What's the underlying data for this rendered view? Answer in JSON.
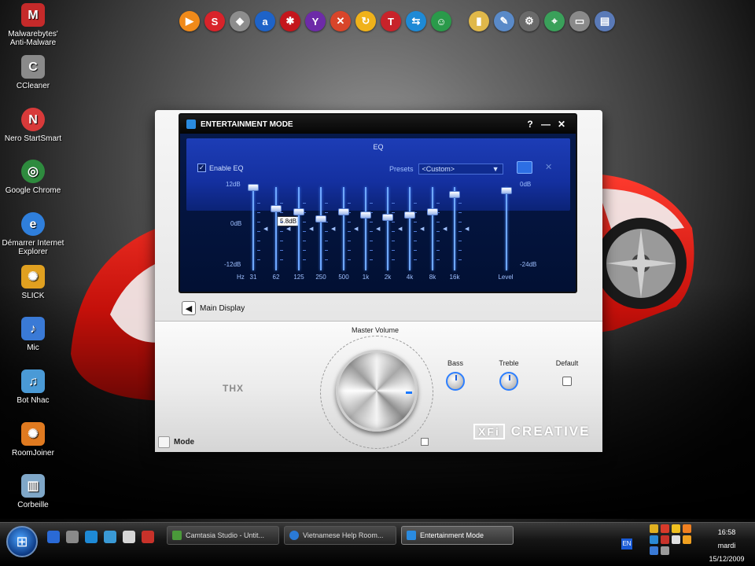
{
  "desktop": {
    "icons": [
      {
        "label": "Malwarebytes' Anti-Malware",
        "icon": "malwarebytes-icon",
        "glyph": "M",
        "color": "#c52a2a"
      },
      {
        "label": "CCleaner",
        "icon": "ccleaner-icon",
        "glyph": "C",
        "color": "#8a8a8a"
      },
      {
        "label": "Nero StartSmart",
        "icon": "nero-icon",
        "glyph": "N",
        "color": "#d83a3a"
      },
      {
        "label": "Google Chrome",
        "icon": "chrome-icon",
        "glyph": "◎",
        "color": "#2e8b3e"
      },
      {
        "label": "Démarrer Internet Explorer",
        "icon": "internet-explorer-icon",
        "glyph": "e",
        "color": "#2f7fdc"
      },
      {
        "label": "SLICK",
        "icon": "slick-icon",
        "glyph": "✺",
        "color": "#e0a020"
      },
      {
        "label": "Mic",
        "icon": "microphone-icon",
        "glyph": "♪",
        "color": "#3a7ad6"
      },
      {
        "label": "Bot Nhac",
        "icon": "bot-nhac-icon",
        "glyph": "♫",
        "color": "#4a9ad6"
      },
      {
        "label": "RoomJoiner",
        "icon": "roomjoiner-icon",
        "glyph": "✺",
        "color": "#e07a20"
      },
      {
        "label": "Corbeille",
        "icon": "recycle-bin-icon",
        "glyph": "▥",
        "color": "#7fa7c8"
      }
    ]
  },
  "top_bar": {
    "icons": [
      {
        "name": "media-player-icon",
        "glyph": "▶",
        "color": "#f08a1a"
      },
      {
        "name": "shell-icon",
        "glyph": "S",
        "color": "#d8232a"
      },
      {
        "name": "shield-icon",
        "glyph": "◆",
        "color": "#8d8d8d"
      },
      {
        "name": "avast-icon",
        "glyph": "a",
        "color": "#1e63c8"
      },
      {
        "name": "spider-icon",
        "glyph": "✱",
        "color": "#c4161c"
      },
      {
        "name": "yahoo-icon",
        "glyph": "Y",
        "color": "#6d2ba8"
      },
      {
        "name": "pinwheel-icon",
        "glyph": "✕",
        "color": "#d8452a"
      },
      {
        "name": "sync-icon",
        "glyph": "↻",
        "color": "#f0b21a"
      },
      {
        "name": "tweak-icon",
        "glyph": "T",
        "color": "#c8232a"
      },
      {
        "name": "teamviewer-icon",
        "glyph": "⇆",
        "color": "#1e8ad6"
      },
      {
        "name": "users-icon",
        "glyph": "☺",
        "color": "#2a9a4a"
      },
      {
        "name": "folder-icon",
        "glyph": "▮",
        "color": "#e0b84a"
      },
      {
        "name": "notepad-icon",
        "glyph": "✎",
        "color": "#5a8ac8"
      },
      {
        "name": "settings-gear-icon",
        "glyph": "⚙",
        "color": "#6a6a6a"
      },
      {
        "name": "map-icon",
        "glyph": "⌖",
        "color": "#3aa05a"
      },
      {
        "name": "network-icon",
        "glyph": "▭",
        "color": "#8a8a8a"
      },
      {
        "name": "monitor-icon",
        "glyph": "▤",
        "color": "#5a7ab8"
      }
    ]
  },
  "window": {
    "title": "ENTERTAINMENT MODE",
    "help_glyph": "?",
    "minimize_glyph": "—",
    "close_glyph": "✕",
    "eq": {
      "heading": "EQ",
      "enable_label": "Enable EQ",
      "enable_checked": "✓",
      "presets_label": "Presets",
      "preset_value": "<Custom>",
      "preset_arrow": "▼",
      "delete_glyph": "✕",
      "db_top": "12dB",
      "db_mid": "0dB",
      "db_bot": "-12dB",
      "level_top": "0dB",
      "level_bot": "-24dB",
      "hz_label": "Hz",
      "tooltip": "5.8dB",
      "bands": [
        {
          "freq": "31",
          "gain": 12
        },
        {
          "freq": "62",
          "gain": 6
        },
        {
          "freq": "125",
          "gain": 5
        },
        {
          "freq": "250",
          "gain": 3
        },
        {
          "freq": "500",
          "gain": 5
        },
        {
          "freq": "1k",
          "gain": 4
        },
        {
          "freq": "2k",
          "gain": 3.5
        },
        {
          "freq": "4k",
          "gain": 4
        },
        {
          "freq": "8k",
          "gain": 5
        },
        {
          "freq": "16k",
          "gain": 10
        }
      ],
      "level": {
        "label": "Level",
        "value_db": 0
      }
    },
    "main_display_label": "Main Display",
    "master_volume_label": "Master Volume",
    "bass_label": "Bass",
    "treble_label": "Treble",
    "default_label": "Default",
    "thx_label": "THX",
    "mode_label": "Mode",
    "brand": "CREATIVE",
    "brand_badge": "XFi"
  },
  "taskbar": {
    "start_glyph": "⊞",
    "tasks": [
      {
        "label": "Camtasia Studio - Untit...",
        "color": "#4a9a3a",
        "active": false
      },
      {
        "label": "Vietnamese Help Room...",
        "color": "#2a7ad6",
        "active": false
      },
      {
        "label": "Entertainment Mode",
        "color": "#2a8be0",
        "active": true
      }
    ],
    "lang": "EN",
    "clock": {
      "time": "16:58",
      "day": "mardi",
      "date": "15/12/2009"
    }
  }
}
